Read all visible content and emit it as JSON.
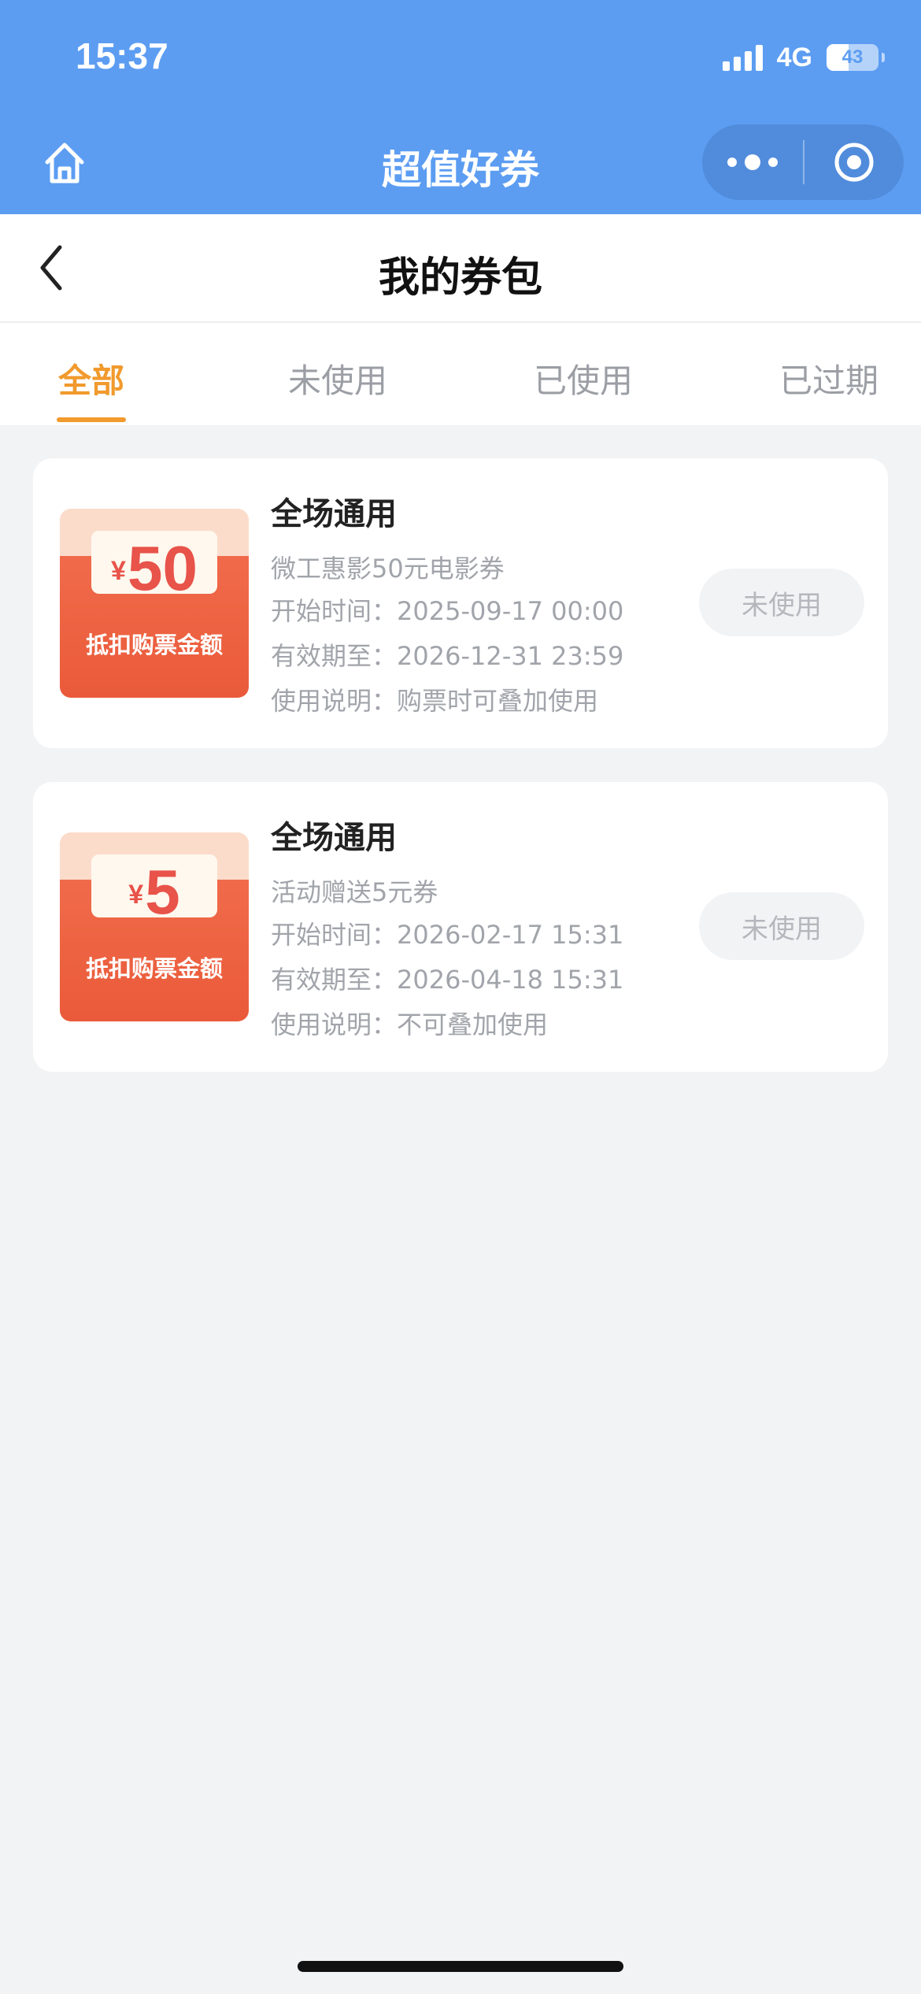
{
  "status_bar": {
    "time": "15:37",
    "network": "4G",
    "battery": "43",
    "battery_level": 0.43
  },
  "miniapp": {
    "title": "超值好券"
  },
  "nav": {
    "title": "我的券包"
  },
  "tabs": [
    {
      "label": "全部",
      "active": true
    },
    {
      "label": "未使用",
      "active": false
    },
    {
      "label": "已使用",
      "active": false
    },
    {
      "label": "已过期",
      "active": false
    }
  ],
  "coupons": [
    {
      "currency": "¥",
      "amount": "50",
      "image_caption": "抵扣购票金额",
      "title": "全场通用",
      "desc": "微工惠影50元电影券",
      "start": "开始时间：2025-09-17 00:00",
      "expire": "有效期至：2026-12-31 23:59",
      "note": "使用说明：购票时可叠加使用",
      "status": "未使用"
    },
    {
      "currency": "¥",
      "amount": "5",
      "image_caption": "抵扣购票金额",
      "title": "全场通用",
      "desc": "活动赠送5元券",
      "start": "开始时间：2026-02-17 15:31",
      "expire": "有效期至：2026-04-18 15:31",
      "note": "使用说明：不可叠加使用",
      "status": "未使用"
    }
  ],
  "colors": {
    "header_blue": "#5c9df2",
    "accent_orange": "#f19a2d",
    "coupon_red": "#e8534a"
  }
}
